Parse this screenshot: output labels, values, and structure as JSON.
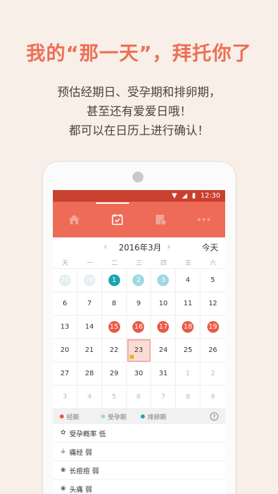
{
  "headline": "我的“那一天”，拜托你了",
  "subtitle_lines": [
    "预估经期日、受孕期和排卵期，",
    "甚至还有爱爱日哦！",
    "都可以在日历上进行确认！"
  ],
  "status_bar": {
    "time": "12:30"
  },
  "tabs": [
    {
      "icon": "home-icon"
    },
    {
      "icon": "calendar-icon",
      "active": true
    },
    {
      "icon": "notes-icon"
    },
    {
      "icon": "more-icon"
    }
  ],
  "calendar": {
    "month_title": "2016年3月",
    "today_label": "今天",
    "weekdays": [
      "天",
      "一",
      "二",
      "三",
      "四",
      "五",
      "六"
    ],
    "weeks": [
      [
        {
          "d": "28",
          "t": "muted"
        },
        {
          "d": "29",
          "t": "muted"
        },
        {
          "d": "1",
          "t": "ovul"
        },
        {
          "d": "2",
          "t": "fertile"
        },
        {
          "d": "3",
          "t": "fertile"
        },
        {
          "d": "4",
          "t": ""
        },
        {
          "d": "5",
          "t": ""
        }
      ],
      [
        {
          "d": "6",
          "t": ""
        },
        {
          "d": "7",
          "t": ""
        },
        {
          "d": "8",
          "t": ""
        },
        {
          "d": "9",
          "t": ""
        },
        {
          "d": "10",
          "t": ""
        },
        {
          "d": "11",
          "t": ""
        },
        {
          "d": "12",
          "t": ""
        }
      ],
      [
        {
          "d": "13",
          "t": ""
        },
        {
          "d": "14",
          "t": ""
        },
        {
          "d": "15",
          "t": "period"
        },
        {
          "d": "16",
          "t": "period"
        },
        {
          "d": "17",
          "t": "period"
        },
        {
          "d": "18",
          "t": "period"
        },
        {
          "d": "19",
          "t": "period"
        }
      ],
      [
        {
          "d": "20",
          "t": ""
        },
        {
          "d": "21",
          "t": ""
        },
        {
          "d": "22",
          "t": ""
        },
        {
          "d": "23",
          "t": "selected"
        },
        {
          "d": "24",
          "t": ""
        },
        {
          "d": "25",
          "t": ""
        },
        {
          "d": "26",
          "t": ""
        }
      ],
      [
        {
          "d": "27",
          "t": ""
        },
        {
          "d": "28",
          "t": ""
        },
        {
          "d": "29",
          "t": ""
        },
        {
          "d": "30",
          "t": ""
        },
        {
          "d": "31",
          "t": ""
        },
        {
          "d": "1",
          "t": "next-month"
        },
        {
          "d": "2",
          "t": "next-month"
        }
      ],
      [
        {
          "d": "3",
          "t": "next-month"
        },
        {
          "d": "4",
          "t": "next-month"
        },
        {
          "d": "5",
          "t": "next-month"
        },
        {
          "d": "6",
          "t": "next-month"
        },
        {
          "d": "7",
          "t": "next-month"
        },
        {
          "d": "8",
          "t": "next-month"
        },
        {
          "d": "9",
          "t": "next-month"
        }
      ]
    ]
  },
  "legend": [
    {
      "label": "经期",
      "color": "#ea5a43"
    },
    {
      "label": "受孕期",
      "color": "#9ed9e1"
    },
    {
      "label": "排卵期",
      "color": "#1aa5b4"
    }
  ],
  "legend_help": "?",
  "info_rows": [
    {
      "icon": "flower-icon",
      "text": "受孕概率 低"
    },
    {
      "icon": "pain-icon",
      "text": "痛经 弱"
    },
    {
      "icon": "acne-icon",
      "text": "长痘痘 弱"
    },
    {
      "icon": "headache-icon",
      "text": "头痛 弱"
    }
  ]
}
